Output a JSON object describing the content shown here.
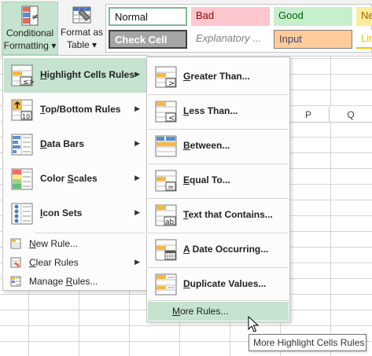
{
  "ribbon": {
    "conditional_formatting": {
      "line1": "Conditional",
      "line2": "Formatting",
      "dropdown": "▾",
      "icon": "conditional-formatting-icon"
    },
    "format_as_table": {
      "line1": "Format as",
      "line2": "Table",
      "dropdown": "▾",
      "icon": "format-as-table-icon"
    },
    "cell_styles": {
      "normal": "Normal",
      "bad": "Bad",
      "good": "Good",
      "neutral": "Ne",
      "check_cell": "Check Cell",
      "explanatory": "Explanatory ...",
      "input": "Input",
      "linked": "Lin"
    }
  },
  "sheet": {
    "columns": [
      "P",
      "Q"
    ]
  },
  "menu": {
    "items": [
      {
        "pre": "",
        "u": "H",
        "post": "ighlight Cells Rules",
        "icon": "highlight-cells-rules-icon",
        "has_submenu": true
      },
      {
        "pre": "",
        "u": "T",
        "post": "op/Bottom Rules",
        "icon": "top-bottom-rules-icon",
        "has_submenu": true
      },
      {
        "pre": "",
        "u": "D",
        "post": "ata Bars",
        "icon": "data-bars-icon",
        "has_submenu": true
      },
      {
        "pre": "Color ",
        "u": "S",
        "post": "cales",
        "icon": "color-scales-icon",
        "has_submenu": true
      },
      {
        "pre": "",
        "u": "I",
        "post": "con Sets",
        "icon": "icon-sets-icon",
        "has_submenu": true
      }
    ],
    "small_items": [
      {
        "pre": "",
        "u": "N",
        "post": "ew Rule...",
        "icon": "new-rule-icon"
      },
      {
        "pre": "",
        "u": "C",
        "post": "lear Rules",
        "icon": "clear-rules-icon",
        "has_submenu": true
      },
      {
        "pre": "Manage ",
        "u": "R",
        "post": "ules...",
        "icon": "manage-rules-icon"
      }
    ],
    "arrow": "▶"
  },
  "submenu": {
    "items": [
      {
        "pre": "",
        "u": "G",
        "post": "reater Than...",
        "icon": "greater-than-icon"
      },
      {
        "pre": "",
        "u": "L",
        "post": "ess Than...",
        "icon": "less-than-icon"
      },
      {
        "pre": "",
        "u": "B",
        "post": "etween...",
        "icon": "between-icon"
      },
      {
        "pre": "",
        "u": "E",
        "post": "qual To...",
        "icon": "equal-to-icon"
      },
      {
        "pre": "",
        "u": "T",
        "post": "ext that Contains...",
        "icon": "text-contains-icon"
      },
      {
        "pre": "",
        "u": "A",
        "post": " Date Occurring...",
        "icon": "date-occurring-icon"
      },
      {
        "pre": "",
        "u": "D",
        "post": "uplicate Values...",
        "icon": "duplicate-values-icon"
      }
    ],
    "more": {
      "pre": "",
      "u": "M",
      "post": "ore Rules..."
    }
  },
  "tooltip": "More Highlight Cells Rules",
  "colors": {
    "accent": "#c5e3cf",
    "accent_border": "#a8d4b5"
  }
}
